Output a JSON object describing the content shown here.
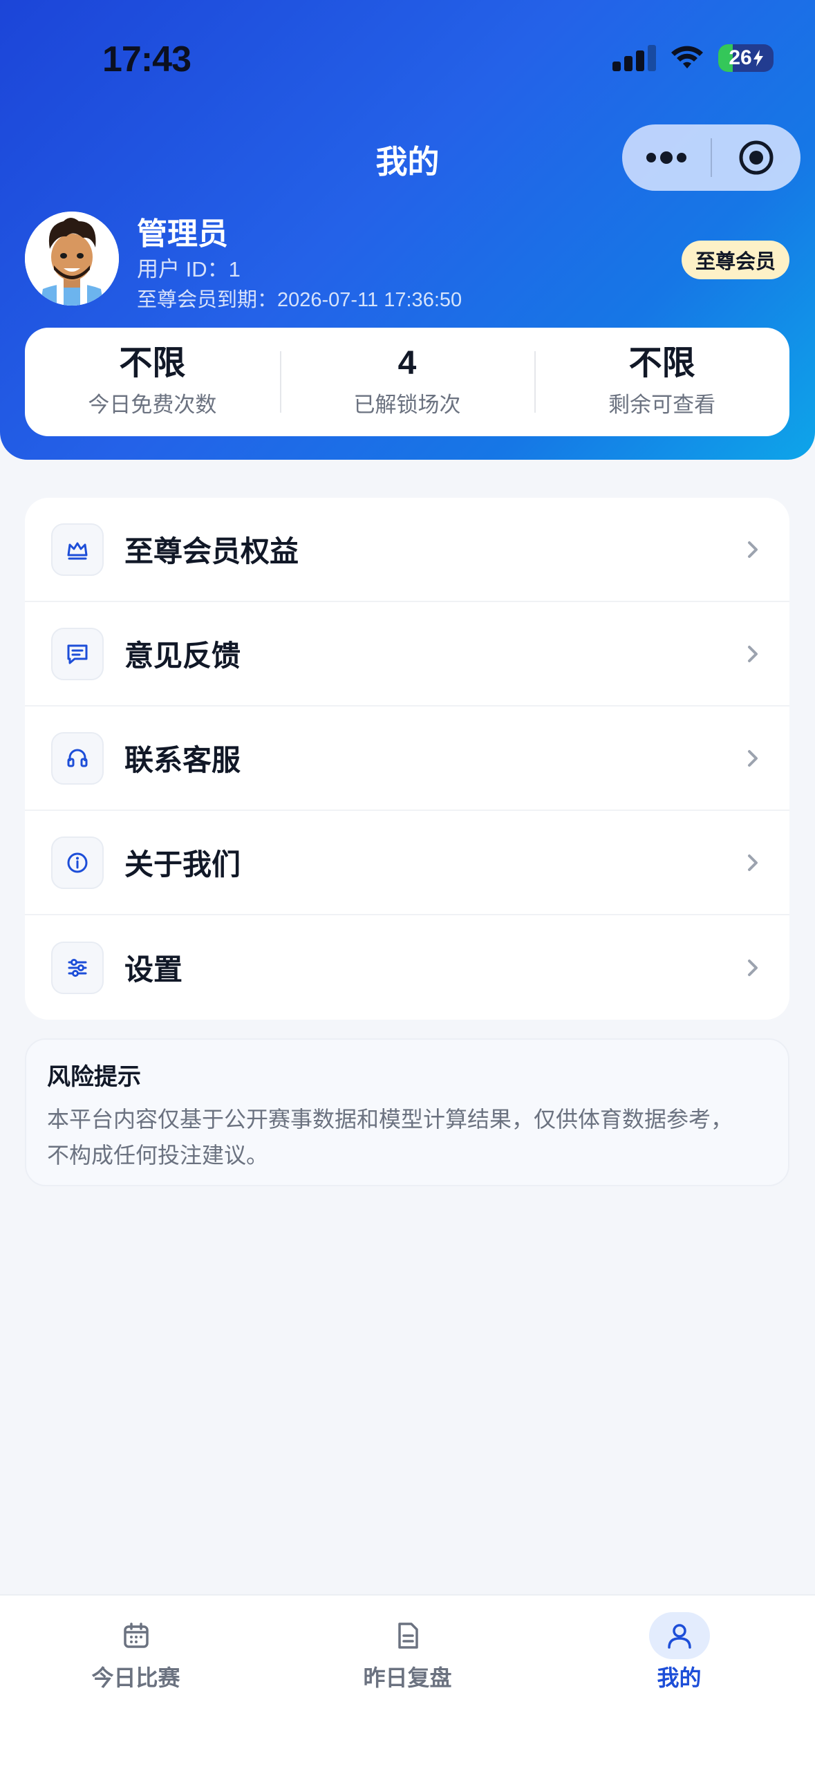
{
  "status_bar": {
    "time": "17:43",
    "battery_level": "26"
  },
  "nav": {
    "title": "我的"
  },
  "profile": {
    "name": "管理员",
    "user_id_text": "用户 ID：1",
    "expiry_text": "至尊会员到期：2026-07-11 17:36:50",
    "vip_badge": "至尊会员"
  },
  "stats": [
    {
      "value": "不限",
      "label": "今日免费次数"
    },
    {
      "value": "4",
      "label": "已解锁场次"
    },
    {
      "value": "不限",
      "label": "剩余可查看"
    }
  ],
  "menu": [
    {
      "label": "至尊会员权益",
      "icon": "crown-icon"
    },
    {
      "label": "意见反馈",
      "icon": "message-icon"
    },
    {
      "label": "联系客服",
      "icon": "headset-icon"
    },
    {
      "label": "关于我们",
      "icon": "info-icon"
    },
    {
      "label": "设置",
      "icon": "sliders-icon"
    }
  ],
  "risk": {
    "title": "风险提示",
    "line1": "本平台内容仅基于公开赛事数据和模型计算结果，仅供体育数据参考，",
    "line2": "不构成任何投注建议。"
  },
  "tabbar": {
    "items": [
      {
        "label": "今日比赛",
        "icon": "calendar-icon",
        "active": false
      },
      {
        "label": "昨日复盘",
        "icon": "document-icon",
        "active": false
      },
      {
        "label": "我的",
        "icon": "user-icon",
        "active": true
      }
    ]
  },
  "colors": {
    "accent": "#1d4ed8",
    "header_gradient_start": "#1c45d8",
    "header_gradient_end": "#0ea5e9",
    "vip_badge_bg": "#fdf1c7",
    "page_bg": "#f4f6fa"
  }
}
